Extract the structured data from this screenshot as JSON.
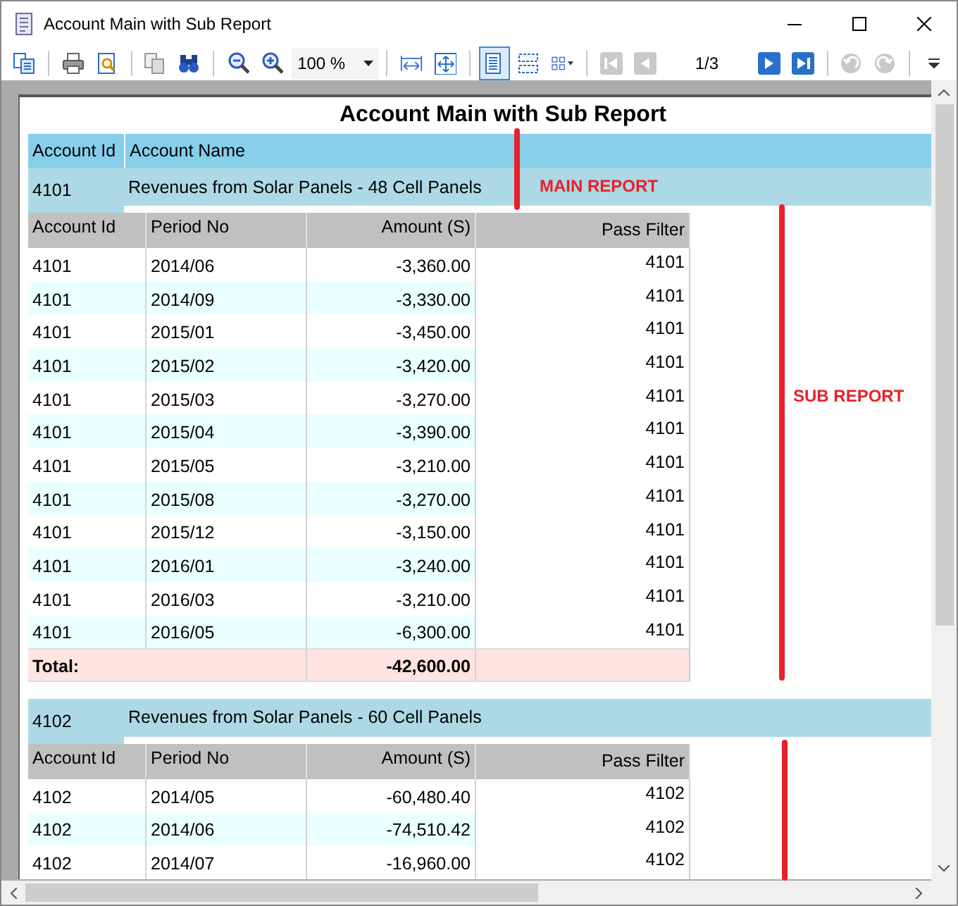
{
  "window": {
    "title": "Account Main with Sub Report"
  },
  "toolbar": {
    "items": [
      {
        "kind": "button",
        "selected": false,
        "disabled": false
      },
      {
        "kind": "separator"
      },
      {
        "kind": "button",
        "selected": false,
        "disabled": false
      },
      {
        "kind": "button",
        "selected": false,
        "disabled": false
      },
      {
        "kind": "separator"
      },
      {
        "kind": "button",
        "selected": false,
        "disabled": false
      },
      {
        "kind": "button",
        "selected": false,
        "disabled": false
      },
      {
        "kind": "separator"
      },
      {
        "kind": "button",
        "selected": false,
        "disabled": false
      },
      {
        "kind": "button",
        "selected": false,
        "disabled": false
      },
      {
        "kind": "combo",
        "value": "100 %"
      },
      {
        "kind": "separator"
      },
      {
        "kind": "button",
        "selected": false,
        "disabled": false
      },
      {
        "kind": "button",
        "selected": false,
        "disabled": false
      },
      {
        "kind": "separator"
      },
      {
        "kind": "button",
        "selected": true,
        "disabled": false
      },
      {
        "kind": "button",
        "selected": false,
        "disabled": false
      },
      {
        "kind": "button",
        "selected": false,
        "disabled": false
      },
      {
        "kind": "separator"
      },
      {
        "kind": "button",
        "selected": false,
        "disabled": true
      },
      {
        "kind": "button",
        "selected": false,
        "disabled": true
      },
      {
        "kind": "pager",
        "value": "1/3"
      },
      {
        "kind": "button",
        "selected": false,
        "disabled": false
      },
      {
        "kind": "button",
        "selected": false,
        "disabled": false
      },
      {
        "kind": "separator"
      },
      {
        "kind": "button",
        "selected": false,
        "disabled": true
      },
      {
        "kind": "button",
        "selected": false,
        "disabled": true
      },
      {
        "kind": "separator"
      }
    ]
  },
  "report": {
    "title": "Account Main with Sub Report",
    "columns": [
      "Account Id",
      "Account Name"
    ],
    "accounts": [
      {
        "id": "4101",
        "name": "Revenues from Solar Panels - 48 Cell Panels",
        "sub_columns": [
          "Account Id",
          "Period No",
          "Amount (S)",
          "Pass Filter"
        ],
        "rows": [
          {
            "account_id": "4101",
            "period": "2014/06",
            "amount": "-3,360.00",
            "pass_filter": "4101"
          },
          {
            "account_id": "4101",
            "period": "2014/09",
            "amount": "-3,330.00",
            "pass_filter": "4101"
          },
          {
            "account_id": "4101",
            "period": "2015/01",
            "amount": "-3,450.00",
            "pass_filter": "4101"
          },
          {
            "account_id": "4101",
            "period": "2015/02",
            "amount": "-3,420.00",
            "pass_filter": "4101"
          },
          {
            "account_id": "4101",
            "period": "2015/03",
            "amount": "-3,270.00",
            "pass_filter": "4101"
          },
          {
            "account_id": "4101",
            "period": "2015/04",
            "amount": "-3,390.00",
            "pass_filter": "4101"
          },
          {
            "account_id": "4101",
            "period": "2015/05",
            "amount": "-3,210.00",
            "pass_filter": "4101"
          },
          {
            "account_id": "4101",
            "period": "2015/08",
            "amount": "-3,270.00",
            "pass_filter": "4101"
          },
          {
            "account_id": "4101",
            "period": "2015/12",
            "amount": "-3,150.00",
            "pass_filter": "4101"
          },
          {
            "account_id": "4101",
            "period": "2016/01",
            "amount": "-3,240.00",
            "pass_filter": "4101"
          },
          {
            "account_id": "4101",
            "period": "2016/03",
            "amount": "-3,210.00",
            "pass_filter": "4101"
          },
          {
            "account_id": "4101",
            "period": "2016/05",
            "amount": "-6,300.00",
            "pass_filter": "4101"
          }
        ],
        "total": {
          "label": "Total:",
          "amount": "-42,600.00"
        }
      },
      {
        "id": "4102",
        "name": "Revenues from Solar Panels - 60 Cell Panels",
        "sub_columns": [
          "Account Id",
          "Period No",
          "Amount (S)",
          "Pass Filter"
        ],
        "rows": [
          {
            "account_id": "4102",
            "period": "2014/05",
            "amount": "-60,480.40",
            "pass_filter": "4102"
          },
          {
            "account_id": "4102",
            "period": "2014/06",
            "amount": "-74,510.42",
            "pass_filter": "4102"
          },
          {
            "account_id": "4102",
            "period": "2014/07",
            "amount": "-16,960.00",
            "pass_filter": "4102"
          }
        ]
      }
    ]
  },
  "annotations": [
    {
      "text": "MAIN REPORT"
    },
    {
      "text": "SUB REPORT"
    }
  ]
}
